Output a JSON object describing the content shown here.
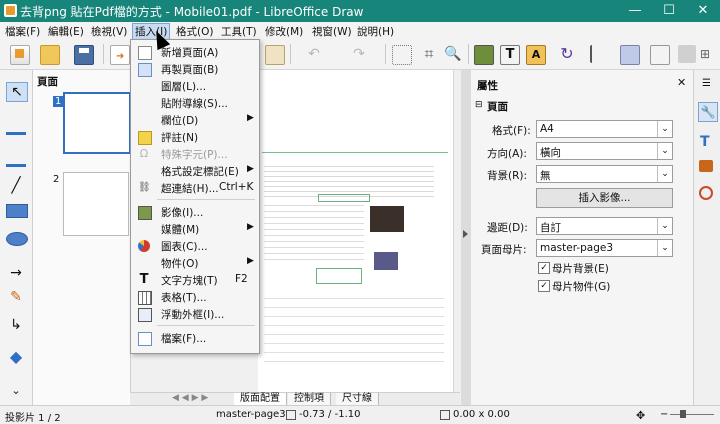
{
  "window": {
    "title": "去背png 貼在Pdf檔的方式 - Mobile01.pdf - LibreOffice Draw",
    "minimize": "—",
    "maximize": "☐",
    "close": "✕"
  },
  "menubar": [
    {
      "label": "檔案(F)"
    },
    {
      "label": "編輯(E)"
    },
    {
      "label": "檢視(V)"
    },
    {
      "label": "插入(I)"
    },
    {
      "label": "格式(O)"
    },
    {
      "label": "工具(T)"
    },
    {
      "label": "修改(M)"
    },
    {
      "label": "視窗(W)"
    },
    {
      "label": "說明(H)"
    }
  ],
  "pages_panel": {
    "title": "頁面",
    "page1": "1",
    "page2": "2"
  },
  "insert_menu": [
    {
      "label": "新增頁面(A)",
      "icon": "new-page-icon"
    },
    {
      "label": "再製頁面(B)",
      "icon": "duplicate-page-icon"
    },
    {
      "label": "圖層(L)...",
      "icon": ""
    },
    {
      "label": "貼附導線(S)...",
      "icon": ""
    },
    {
      "label": "欄位(D)",
      "icon": "",
      "submenu": "▶"
    },
    {
      "label": "評註(N)",
      "icon": "comment-icon"
    },
    {
      "label": "特殊字元(P)...",
      "icon": "omega-icon",
      "disabled": true
    },
    {
      "label": "格式設定標記(E)",
      "icon": "",
      "submenu": "▶"
    },
    {
      "label": "超連結(H)...",
      "icon": "hyperlink-icon",
      "shortcut": "Ctrl+K"
    },
    {
      "label": "影像(I)...",
      "icon": "image-icon"
    },
    {
      "label": "媒體(M)",
      "icon": "",
      "submenu": "▶"
    },
    {
      "label": "圖表(C)...",
      "icon": "chart-icon"
    },
    {
      "label": "物件(O)",
      "icon": "",
      "submenu": "▶"
    },
    {
      "label": "文字方塊(T)",
      "icon": "text-box-icon",
      "shortcut": "F2"
    },
    {
      "label": "表格(T)...",
      "icon": "table-icon"
    },
    {
      "label": "浮動外框(I)...",
      "icon": "floating-frame-icon"
    },
    {
      "label": "檔案(F)...",
      "icon": "file-icon"
    }
  ],
  "properties": {
    "title": "屬性",
    "close": "✕",
    "section": "頁面",
    "format_label": "格式(F):",
    "format_value": "A4",
    "orientation_label": "方向(A):",
    "orientation_value": "橫向",
    "background_label": "背景(R):",
    "background_value": "無",
    "insert_image_button": "插入影像...",
    "margin_label": "邊距(D):",
    "margin_value": "自訂",
    "master_page_label": "頁面母片:",
    "master_page_value": "master-page3",
    "master_background_label": "母片背景(E)",
    "master_objects_label": "母片物件(G)"
  },
  "tabs": [
    "版面配置",
    "控制項",
    "尺寸線"
  ],
  "status": {
    "slide": "投影片 1 / 2",
    "master": "master-page3",
    "position": "-0.73 / -1.10",
    "size": "0.00 x 0.00"
  },
  "colors": {
    "titlebar": "#17857a",
    "menu_highlight": "#c8dbf1",
    "accent_blue": "#2f6fc4"
  }
}
